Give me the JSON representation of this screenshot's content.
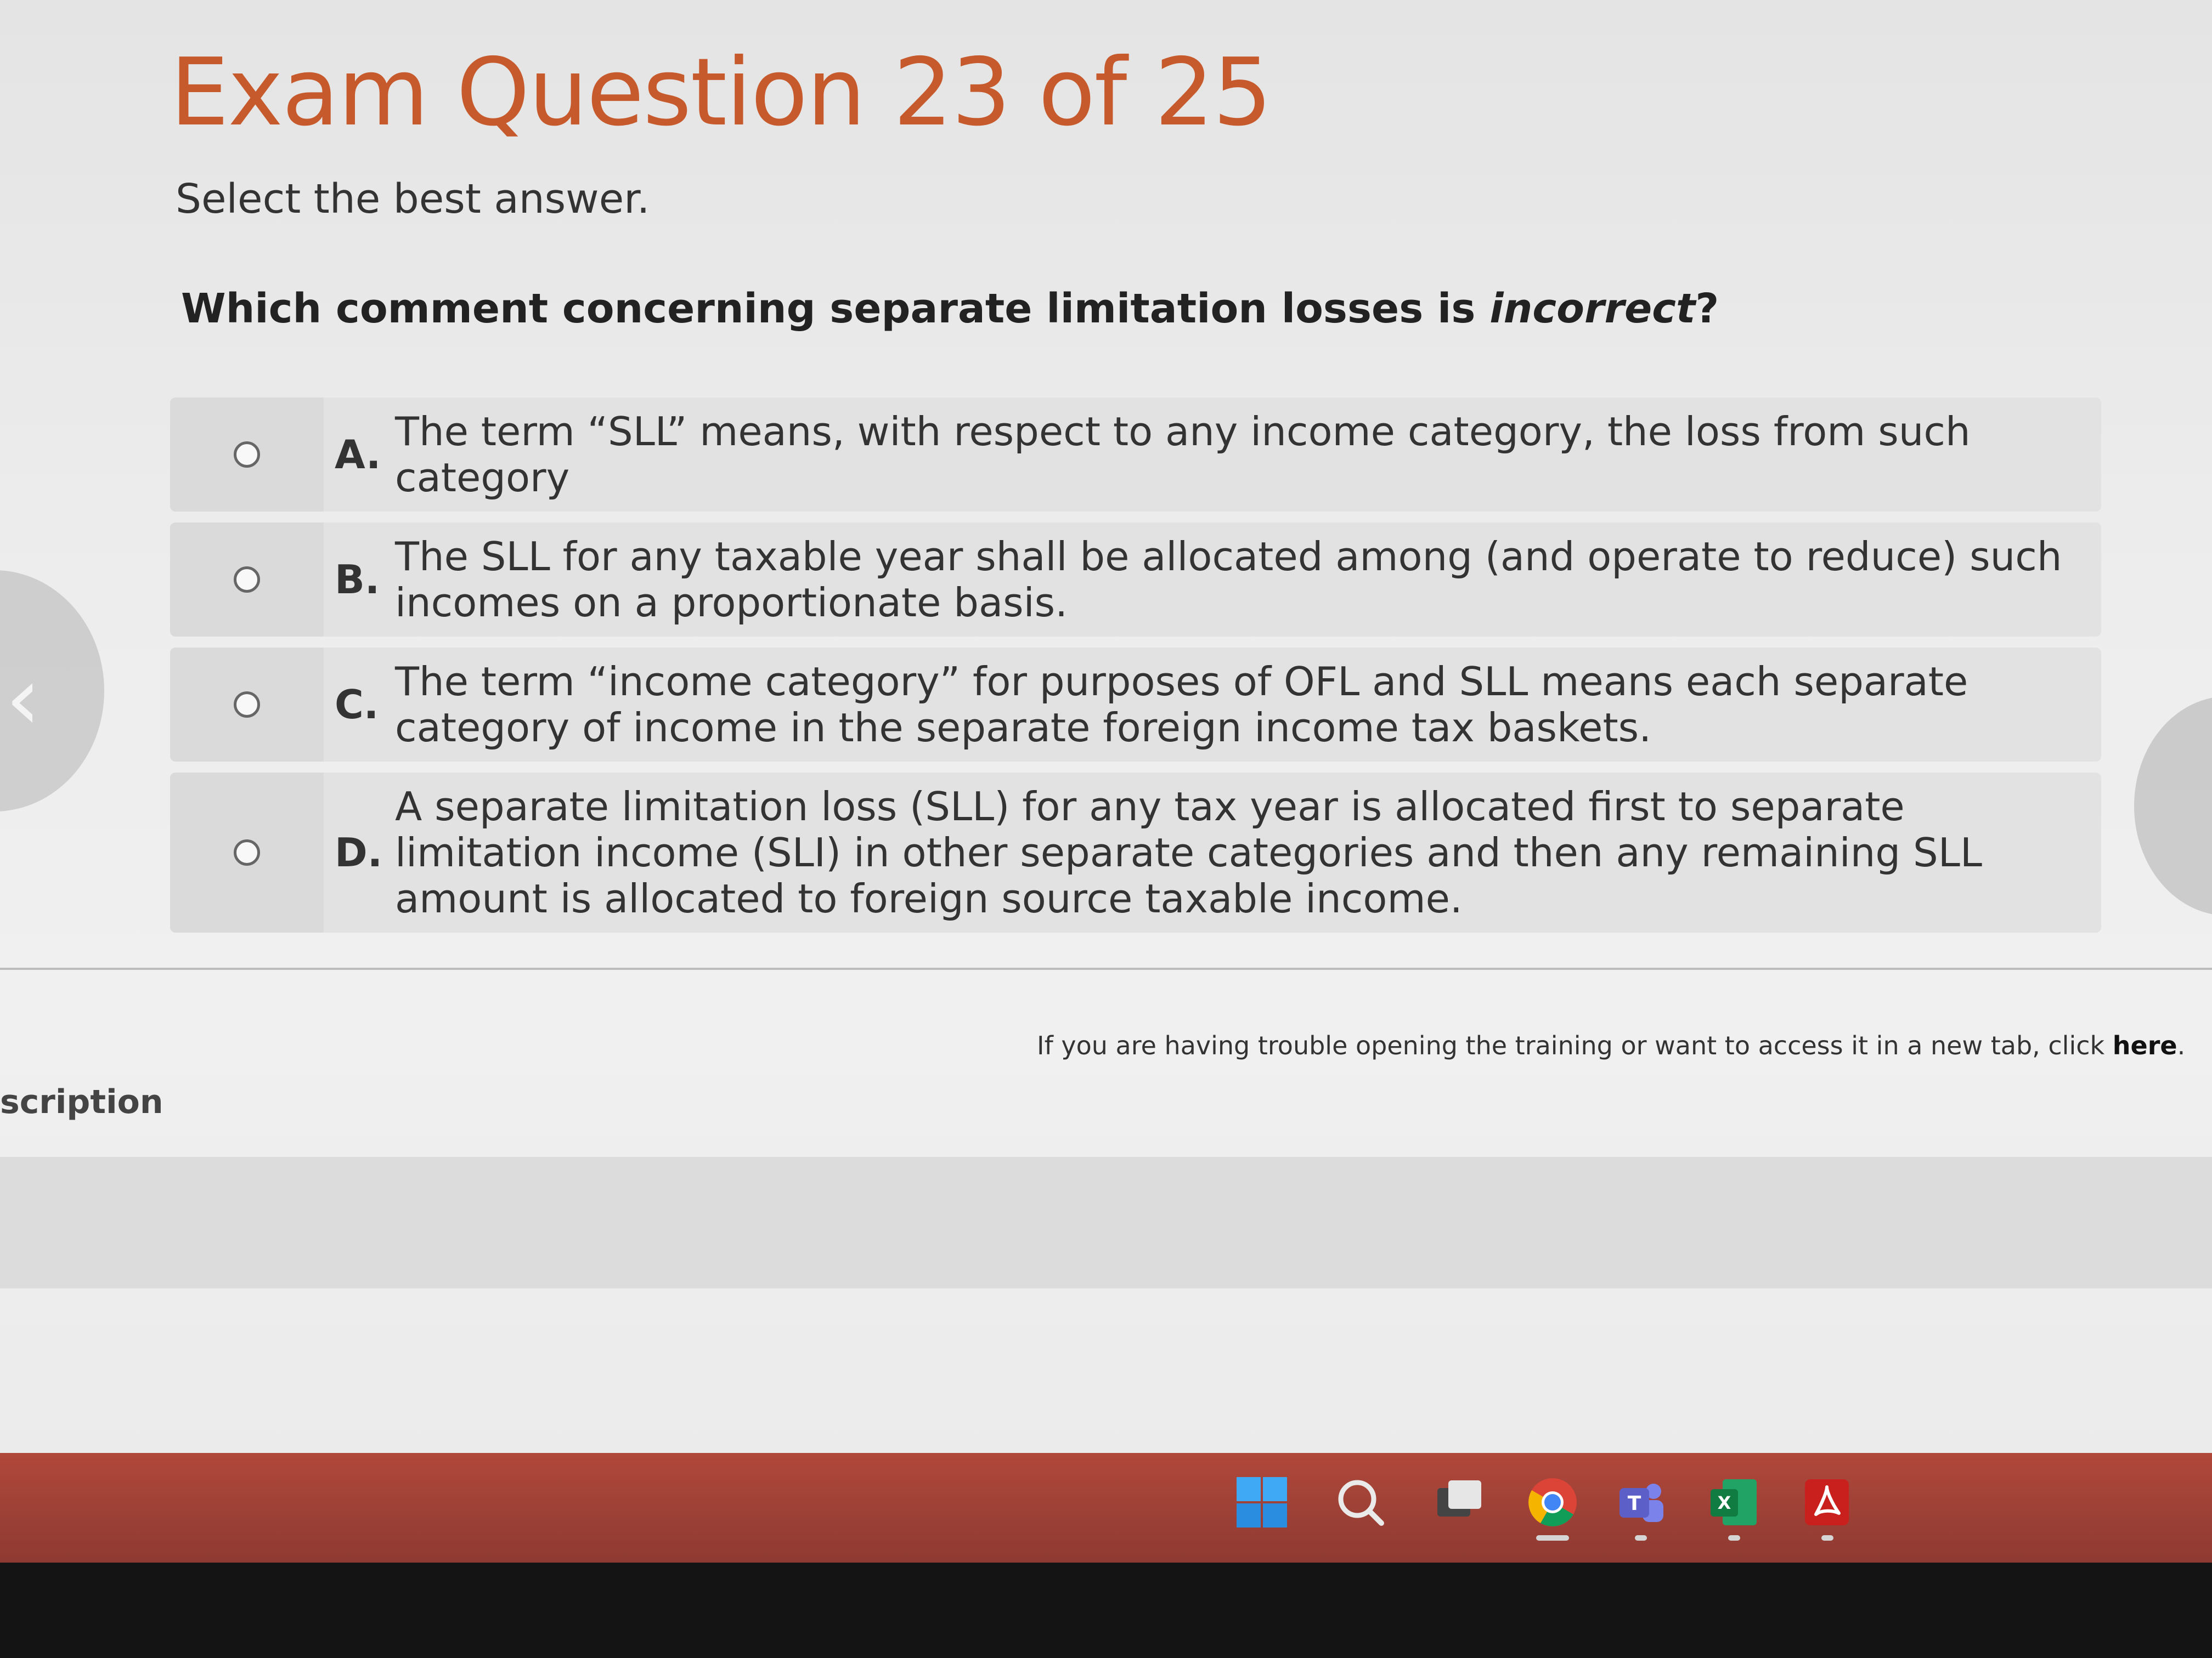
{
  "exam": {
    "title": "Exam Question 23 of 25",
    "instruction": "Select the best answer.",
    "question_prefix": "Which comment concerning separate limitation losses is ",
    "question_emphasis": "incorrect",
    "question_suffix": "?"
  },
  "answers": [
    {
      "letter": "A.",
      "text": "The term “SLL” means, with respect to any income category, the loss from such category"
    },
    {
      "letter": "B.",
      "text": "The SLL for any taxable year shall be allocated among (and operate to reduce) such incomes on a proportionate basis."
    },
    {
      "letter": "C.",
      "text": "The term “income category” for purposes of OFL and SLL means each separate category of income in the separate foreign income tax baskets."
    },
    {
      "letter": "D.",
      "text": "A separate limitation loss (SLL) for any tax year is allocated first to separate limitation income (SLI) in other separate categories and then any remaining SLL amount is allocated to foreign source taxable income."
    }
  ],
  "footer": {
    "trouble_text": "If you are having trouble opening the training or want to access it in a new tab, click ",
    "trouble_link": "here",
    "trouble_end": ".",
    "side_label": "scription"
  },
  "nav": {
    "left_arrow": "‹"
  },
  "taskbar": {
    "icons": [
      "windows-start-icon",
      "search-icon",
      "task-view-icon",
      "chrome-icon",
      "teams-icon",
      "excel-icon",
      "acrobat-icon"
    ],
    "colors": {
      "bar": "#a3433a",
      "chrome_red": "#db4437",
      "chrome_yellow": "#f4b400",
      "chrome_green": "#0f9d58",
      "chrome_blue": "#4285f4",
      "teams": "#5b5fc7",
      "excel": "#107c41",
      "acrobat": "#c9201e"
    }
  },
  "colors": {
    "title": "#c75a2c"
  }
}
